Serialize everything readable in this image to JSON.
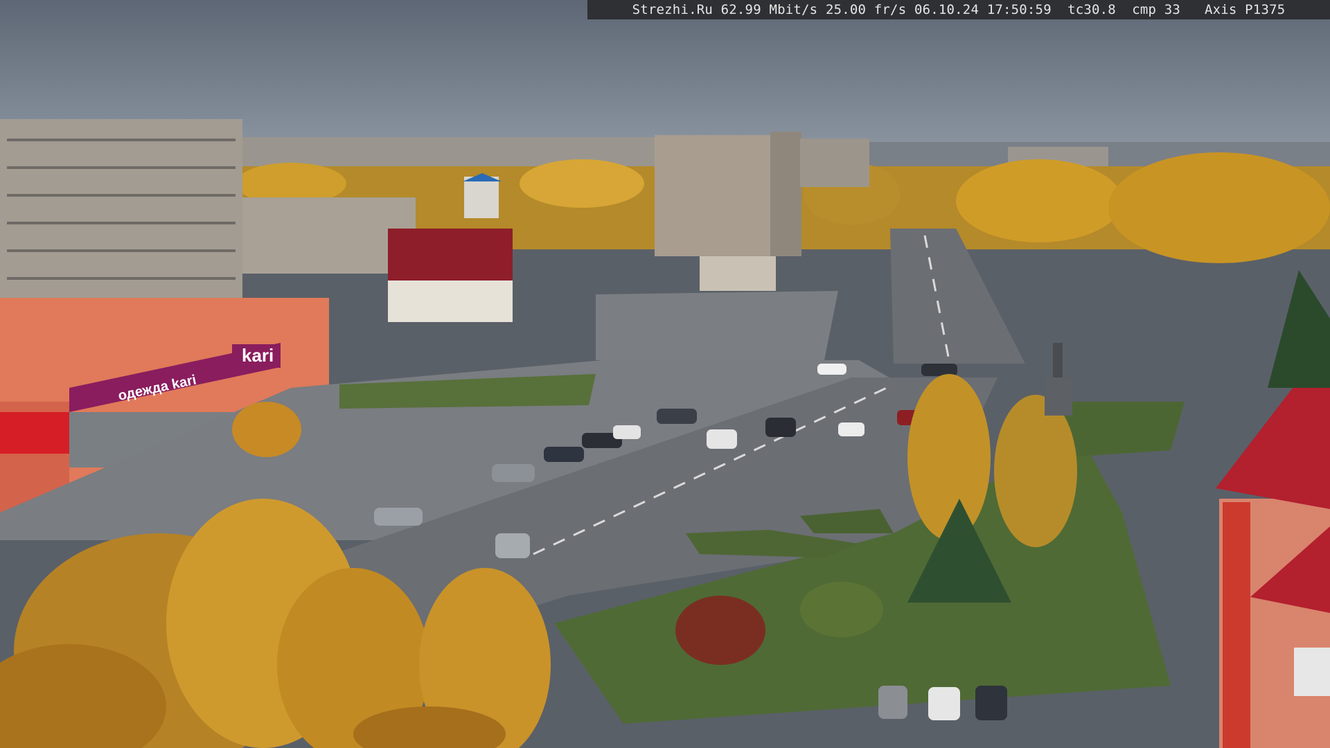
{
  "camera_overlay": {
    "text": "Strezhi.Ru 62.99 Mbit/s 25.00 fr/s 06.10.24 17:50:59  tc30.8  cmp 33   Axis P1375"
  },
  "signage": {
    "store_logo": "kari",
    "store_banner": "одежда kari"
  },
  "colors": {
    "sky": "#6e7885",
    "road": "#6b6e73",
    "autumn_foliage": "#c89a2a",
    "grass": "#4f6a35",
    "store_facade": "#e07a5a",
    "store_banner": "#8a1d5e",
    "roof_red": "#a8202e"
  }
}
